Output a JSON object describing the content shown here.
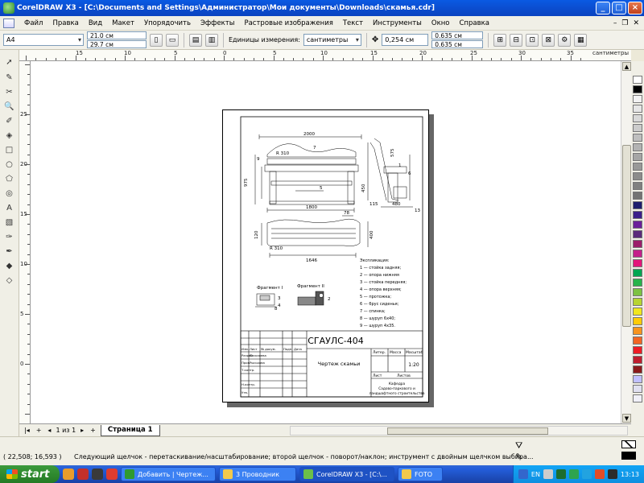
{
  "window": {
    "title": "CorelDRAW X3 - [C:\\Documents and Settings\\Администратор\\Мои документы\\Downloads\\скамья.cdr]",
    "buttons": [
      "_",
      "□",
      "×"
    ]
  },
  "menu": {
    "items": [
      "Файл",
      "Правка",
      "Вид",
      "Макет",
      "Упорядочить",
      "Эффекты",
      "Растровые изображения",
      "Текст",
      "Инструменты",
      "Окно",
      "Справка"
    ]
  },
  "propbar": {
    "paper_size": "A4",
    "width": "21.0 см",
    "height": "29.7 см",
    "units_label": "Единицы измерения:",
    "units_value": "сантиметры",
    "nudge": "0,254 см",
    "dup_x": "0.635 см",
    "dup_y": "0.635 см"
  },
  "rulers": {
    "unit_label": "сантиметры",
    "h_labels": [
      "15",
      "10",
      "5",
      "0",
      "5",
      "10",
      "15",
      "20",
      "25",
      "30",
      "35"
    ],
    "v_labels": [
      "25",
      "20",
      "15",
      "10",
      "5",
      "0"
    ]
  },
  "drawing": {
    "dims": [
      "2000",
      "1800",
      "975",
      "450",
      "1646",
      "400",
      "120",
      "R 310",
      "R 310",
      "575",
      "78",
      "115",
      "480",
      "13",
      "1",
      "2",
      "3",
      "4",
      "5",
      "6",
      "7",
      "8",
      "9"
    ],
    "fragment1": "Фрагмент I",
    "fragment2": "Фрагмент II",
    "legend_title": "Экспликация:",
    "legend": [
      "1 — стойка задняя;",
      "2 — опора нижняя",
      "3 — стойка передняя;",
      "4 — опора верхняя;",
      "5 — протожка;",
      "6 — брус сиденья;",
      "7 — спинка;",
      "8 — шуруп 6х40;",
      "9 — шуруп 4х35."
    ],
    "title_block": {
      "code": "СГАУЛС-404",
      "name": "Чертеж скамьи",
      "lit": "Литер.",
      "mass": "Масса",
      "scale_label": "Масштаб",
      "scale": "1:20",
      "sheet": "Лист",
      "sheets": "Листов",
      "dept_lines": [
        "Кафедра",
        "Садово-паркового и",
        "ландшафтного строительства"
      ],
      "rows": [
        "Изм.",
        "Лист",
        "№ докум.",
        "Подп.",
        "Дата",
        "Разраб.",
        "Бескаяева",
        "Пров.",
        "Рыськова",
        "Т.контр.",
        "Н.контр.",
        "Утв."
      ]
    }
  },
  "pagebar": {
    "counter": "1 из 1",
    "tab": "Страница 1"
  },
  "status": {
    "coords": "( 22,508; 16,593 )",
    "hint": "Следующий щелчок - перетаскивание/насштабирование; второй щелчок - поворот/наклон; инструмент с двойным щелчком выбира..."
  },
  "taskbar": {
    "start": "start",
    "tasks": [
      "Добавить | Чертеж...",
      "3 Проводник",
      "CorelDRAW X3 - [C:\\...",
      "FOTO"
    ],
    "lang": "EN",
    "clock": "13:13"
  },
  "palette": [
    "#ffffff",
    "#000000",
    "#f2f2f2",
    "#e6e6e6",
    "#d9d9d9",
    "#cccccc",
    "#bfbfbf",
    "#b3b3b3",
    "#a6a6a6",
    "#999999",
    "#8c8c8c",
    "#808080",
    "#737373",
    "#1e1e6e",
    "#3b1f8a",
    "#6b1f9a",
    "#5a2a7a",
    "#9b1e6a",
    "#c41e8a",
    "#e3157a",
    "#00a651",
    "#27b34b",
    "#7dc242",
    "#b7d431",
    "#f0e61e",
    "#ffcb05",
    "#f7941d",
    "#f26522",
    "#ed1c24",
    "#be1e2d",
    "#8b1a1a",
    "#c0c0ff",
    "#e0e0f0",
    "#f0f0f8"
  ]
}
